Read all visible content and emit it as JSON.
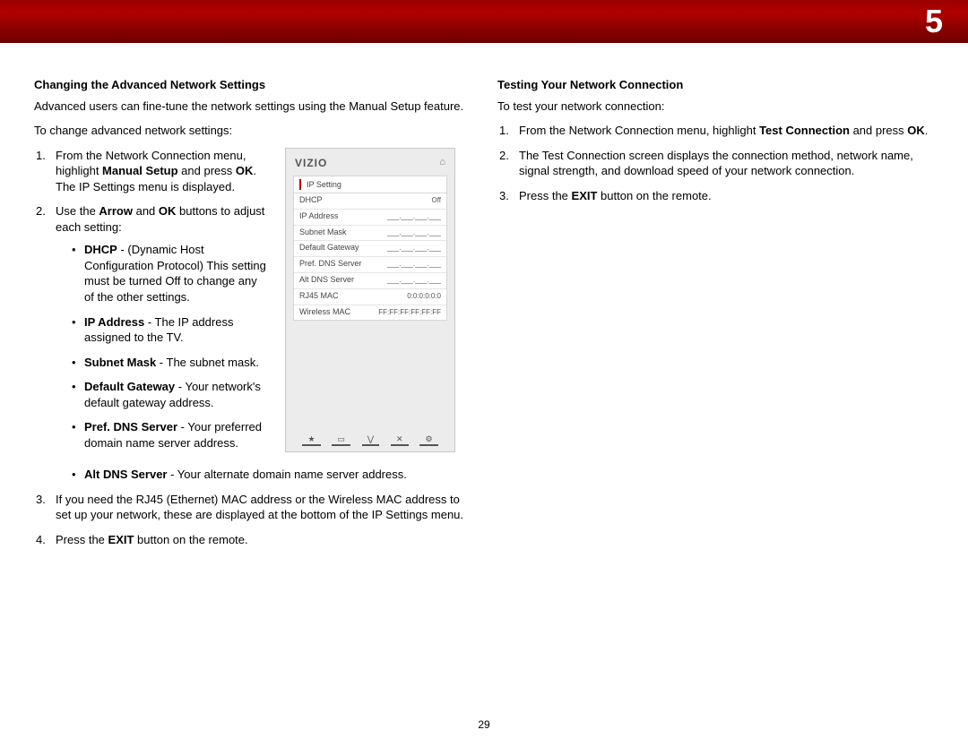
{
  "header": {
    "chapter": "5"
  },
  "page_number": "29",
  "left": {
    "heading": "Changing the Advanced Network Settings",
    "intro": "Advanced users can fine-tune the network settings using the Manual Setup feature.",
    "lead": "To change advanced network settings:",
    "step1_a": "From the Network Connection menu, highlight ",
    "step1_b": "Manual Setup",
    "step1_c": " and press ",
    "step1_d": "OK",
    "step1_e": ". The IP Settings menu is displayed.",
    "step2_a": "Use the ",
    "step2_b": "Arrow",
    "step2_c": " and ",
    "step2_d": "OK",
    "step2_e": " buttons to adjust each setting:",
    "bullets": {
      "dhcp_k": "DHCP",
      "dhcp_v": " - (Dynamic Host Configuration Protocol) This setting must be turned Off to change any of the other settings.",
      "ip_k": "IP Address",
      "ip_v": " - The IP address assigned to the TV.",
      "sm_k": "Subnet Mask",
      "sm_v": " - The subnet mask.",
      "dg_k": "Default Gateway",
      "dg_v": " - Your network's default gateway address.",
      "pd_k": "Pref. DNS Server",
      "pd_v": " - Your preferred domain name server address.",
      "ad_k": "Alt DNS Server",
      "ad_v": " - Your alternate domain name server address."
    },
    "step3": "If you need the RJ45 (Ethernet) MAC address or the Wireless MAC address to set up your network, these are displayed at the bottom of the IP Settings menu.",
    "step4_a": "Press the ",
    "step4_b": "EXIT",
    "step4_c": " button on the remote."
  },
  "figure": {
    "logo": "VIZIO",
    "home_icon": "⌂",
    "title": "IP Setting",
    "blank_val": "___.___.___.___",
    "rows": [
      {
        "k": "DHCP",
        "v": "Off"
      },
      {
        "k": "IP Address",
        "v": "___.___.___.___"
      },
      {
        "k": "Subnet Mask",
        "v": "___.___.___.___"
      },
      {
        "k": "Default Gateway",
        "v": "___.___.___.___"
      },
      {
        "k": "Pref. DNS Server",
        "v": "___.___.___.___"
      },
      {
        "k": "Alt DNS Server",
        "v": "___.___.___.___"
      },
      {
        "k": "RJ45 MAC",
        "v": "0:0:0:0:0:0"
      },
      {
        "k": "Wireless MAC",
        "v": "FF:FF:FF:FF:FF:FF"
      }
    ],
    "toolbar": [
      "★",
      "▭",
      "⋁",
      "✕",
      "⚙"
    ]
  },
  "right": {
    "heading": "Testing Your Network Connection",
    "intro": "To test your network connection:",
    "step1_a": "From the Network Connection menu, highlight ",
    "step1_b": "Test Connection",
    "step1_c": " and press ",
    "step1_d": "OK",
    "step1_e": ".",
    "step2": "The Test Connection screen displays the connection method, network name, signal strength, and download speed of your network connection.",
    "step3_a": "Press the ",
    "step3_b": "EXIT",
    "step3_c": " button on the remote."
  }
}
